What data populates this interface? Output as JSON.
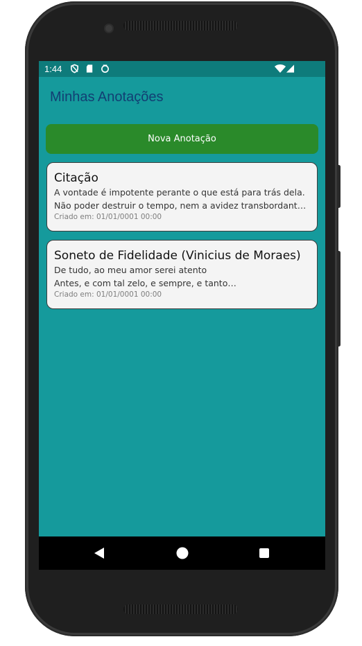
{
  "status_bar": {
    "time": "1:44",
    "icons": [
      "shield-icon",
      "sd-card-icon",
      "sync-icon",
      "wifi-icon",
      "signal-icon"
    ]
  },
  "app": {
    "title": "Minhas Anotações",
    "new_button_label": "Nova Anotação"
  },
  "notes": [
    {
      "title": "Citação",
      "lines": [
        "A vontade é impotente perante o que está para trás dela.",
        "Não poder destruir o tempo, nem a avidez transbordant…"
      ],
      "date": "Criado em: 01/01/0001 00:00"
    },
    {
      "title": "Soneto de Fidelidade (Vinicius de Moraes)",
      "lines": [
        "De tudo, ao meu amor serei atento",
        "Antes, e com tal zelo, e sempre, e tanto…"
      ],
      "date": "Criado em: 01/01/0001 00:00"
    }
  ],
  "nav": {
    "icons": [
      "back-icon",
      "home-icon",
      "recents-icon"
    ]
  },
  "colors": {
    "screen_background": "#159a9c",
    "status_bar": "#0e7b7b",
    "title_text": "#123f73",
    "new_button": "#2a8a2a",
    "card_background": "#f4f4f4"
  }
}
